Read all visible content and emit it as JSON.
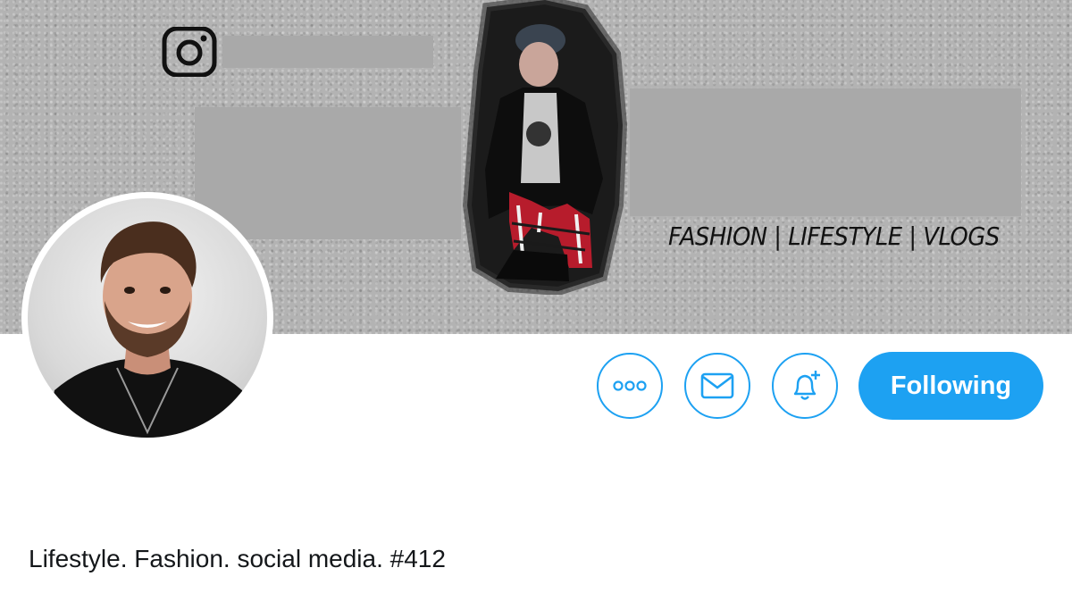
{
  "banner": {
    "tagline": "FASHION | LIFESTYLE | VLOGS",
    "icon": "instagram-icon"
  },
  "actions": {
    "more_icon": "more-icon",
    "message_icon": "mail-icon",
    "notify_icon": "bell-plus-icon",
    "follow_label": "Following"
  },
  "profile": {
    "bio": "Lifestyle. Fashion. social media. #412"
  },
  "colors": {
    "accent": "#1da1f2",
    "redaction": "#a9a9a9",
    "text": "#14171a"
  }
}
